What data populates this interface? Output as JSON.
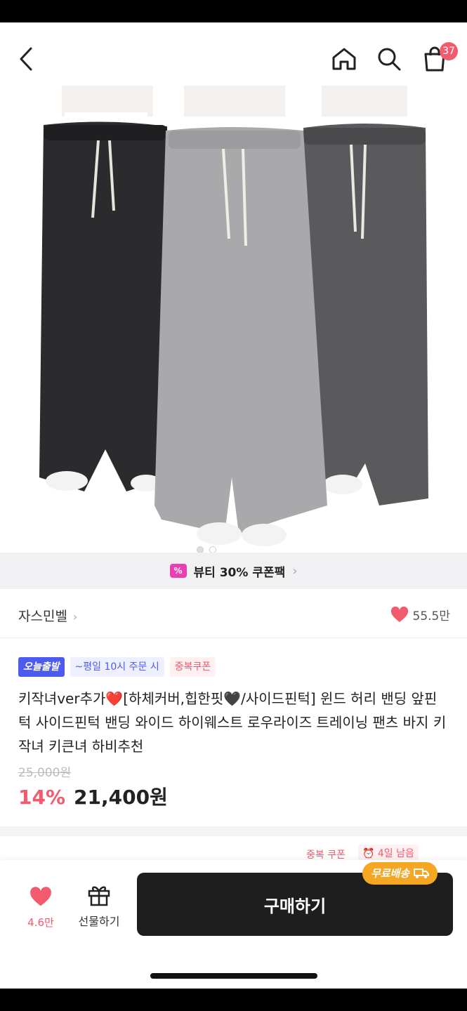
{
  "nav": {
    "cart_count": "37"
  },
  "coupon_strip": {
    "icon_text": "%",
    "label": "뷰티 30% 쿠폰팩"
  },
  "brand": {
    "name": "자스민벨",
    "likes": "55.5만"
  },
  "tags": {
    "today": "오늘출발",
    "time": "~평일 10시 주문 시",
    "coupon": "중복쿠폰"
  },
  "product": {
    "title": "키작녀ver추가❤️[하체커버,힙한핏🖤/사이드핀턱] 윈드 허리 밴딩 앞핀턱 사이드핀턱 밴딩 와이드 하이웨스트 로우라이즈 트레이닝 팬츠 바지 키작녀 키큰녀 하비추천",
    "original_price": "25,000원",
    "discount": "14%",
    "price": "21,400원"
  },
  "peek": {
    "coupon": "중복 쿠폰",
    "days_left": "4일 남음"
  },
  "bottom": {
    "wish_count": "4.6만",
    "gift_label": "선물하기",
    "buy_label": "구매하기",
    "free_shipping": "무료배송"
  },
  "colors": {
    "accent_pink": "#f25a6e",
    "tag_blue": "#4d5bf0",
    "free_ship_orange": "#f5a623"
  },
  "icons": [
    "back-chevron-icon",
    "home-icon",
    "search-icon",
    "cart-bag-icon",
    "heart-icon",
    "gift-icon",
    "truck-icon",
    "alarm-icon"
  ]
}
